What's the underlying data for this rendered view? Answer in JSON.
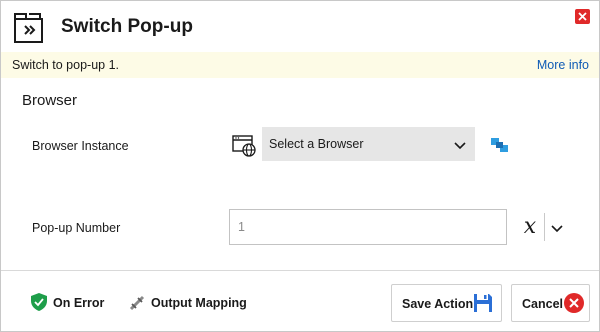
{
  "dialog": {
    "title": "Switch Pop-up",
    "title_icon": "switch-window-icon",
    "close_icon": "close-icon"
  },
  "infobar": {
    "description": "Switch to pop-up 1.",
    "more_info": "More info"
  },
  "section": {
    "title": "Browser"
  },
  "fields": {
    "browser_instance": {
      "label": "Browser Instance",
      "selected": "Select a Browser",
      "icon": "browser-globe-icon",
      "link_icon": "link-browser-icon"
    },
    "popup_number": {
      "label": "Pop-up Number",
      "value": "1",
      "variable_symbol": "x"
    }
  },
  "footer": {
    "on_error": "On Error",
    "output_mapping": "Output Mapping",
    "save_action": "Save Action",
    "cancel": "Cancel"
  },
  "colors": {
    "accent_link": "#0f5bb5",
    "close_red": "#e02929",
    "info_background": "#fdfbe6",
    "shield_green": "#1e9e4a",
    "save_blue": "#2b6fd6",
    "select_background": "#e6e6e6"
  }
}
